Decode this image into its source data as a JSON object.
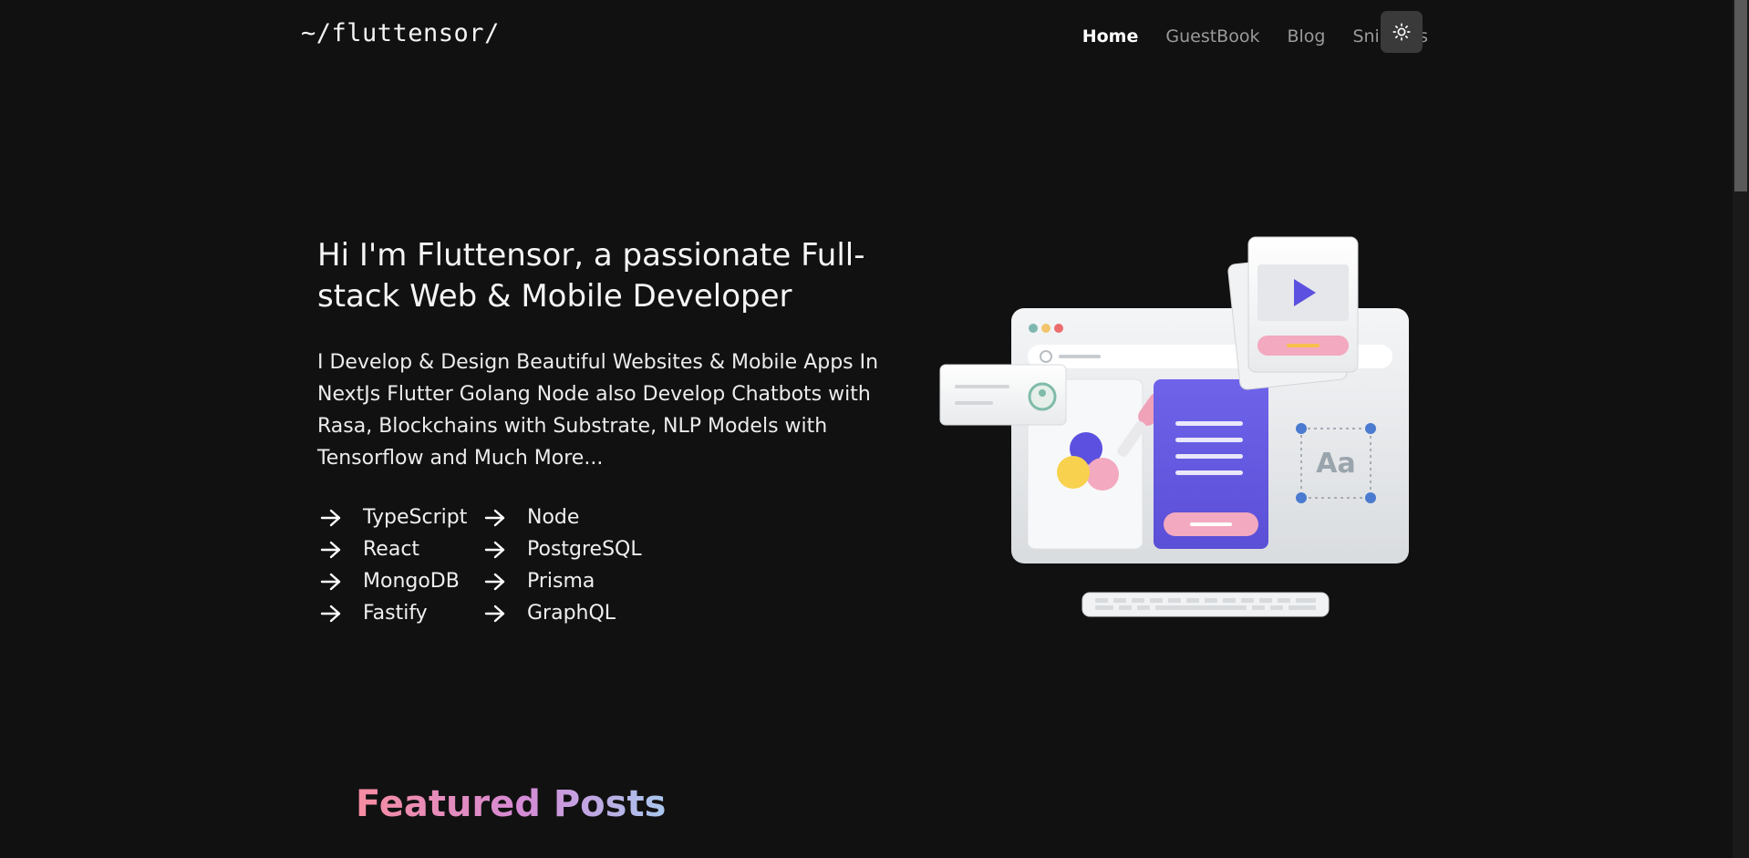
{
  "header": {
    "logo": "~/fluttensor/",
    "nav": [
      {
        "label": "Home",
        "active": true
      },
      {
        "label": "GuestBook",
        "active": false
      },
      {
        "label": "Blog",
        "active": false
      },
      {
        "label": "Snippets",
        "active": false
      }
    ],
    "theme_toggle_icon": "sun-icon"
  },
  "hero": {
    "title": "Hi I'm Fluttensor, a passionate Full-stack Web & Mobile Developer",
    "description": "I Develop & Design Beautiful Websites & Mobile Apps In NextJs Flutter Golang Node also Develop Chatbots with Rasa, Blockchains with Substrate, NLP Models with Tensorflow and Much More...",
    "skills": [
      "TypeScript",
      "Node",
      "React",
      "PostgreSQL",
      "MongoDB",
      "Prisma",
      "Fastify",
      "GraphQL"
    ],
    "illustration_text": "Aa"
  },
  "featured": {
    "title": "Featured Posts"
  },
  "colors": {
    "background": "#111111",
    "accent_purple": "#6a5de0",
    "accent_pink": "#f0a6bd",
    "gradient_start": "#f78ca0",
    "gradient_end": "#a9c7ee"
  }
}
